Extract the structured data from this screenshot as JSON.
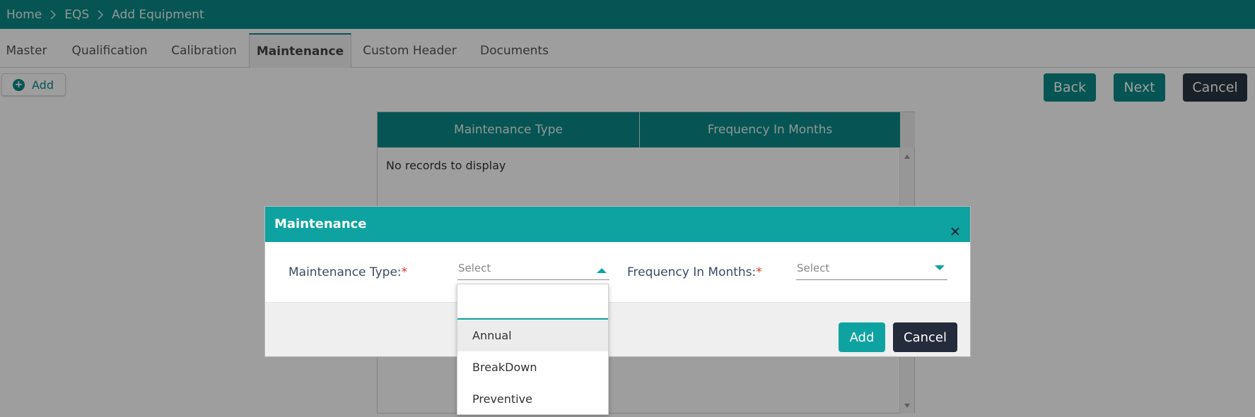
{
  "breadcrumb": [
    "Home",
    "EQS",
    "Add Equipment"
  ],
  "tabs": [
    "Master",
    "Qualification",
    "Calibration",
    "Maintenance",
    "Custom Header",
    "Documents"
  ],
  "active_tab": "Maintenance",
  "toolbar": {
    "add_label": "Add",
    "back_label": "Back",
    "next_label": "Next",
    "cancel_label": "Cancel"
  },
  "grid": {
    "columns": [
      "Maintenance Type",
      "Frequency In Months"
    ],
    "empty_text": "No records to display"
  },
  "modal": {
    "title": "Maintenance",
    "maintenance_type_label": "Maintenance Type:",
    "frequency_label": "Frequency In Months:",
    "required_mark": "*",
    "maintenance_type_placeholder": "Select",
    "frequency_placeholder": "Select",
    "add_label": "Add",
    "cancel_label": "Cancel"
  },
  "dropdown": {
    "search_value": "",
    "options": [
      "Annual",
      "BreakDown",
      "Preventive"
    ],
    "hovered_option": "Annual"
  },
  "colors": {
    "header_teal": "#0a8a88",
    "modal_teal": "#0ea3a1",
    "dark_button": "#242b3a",
    "required": "#e0342b"
  }
}
